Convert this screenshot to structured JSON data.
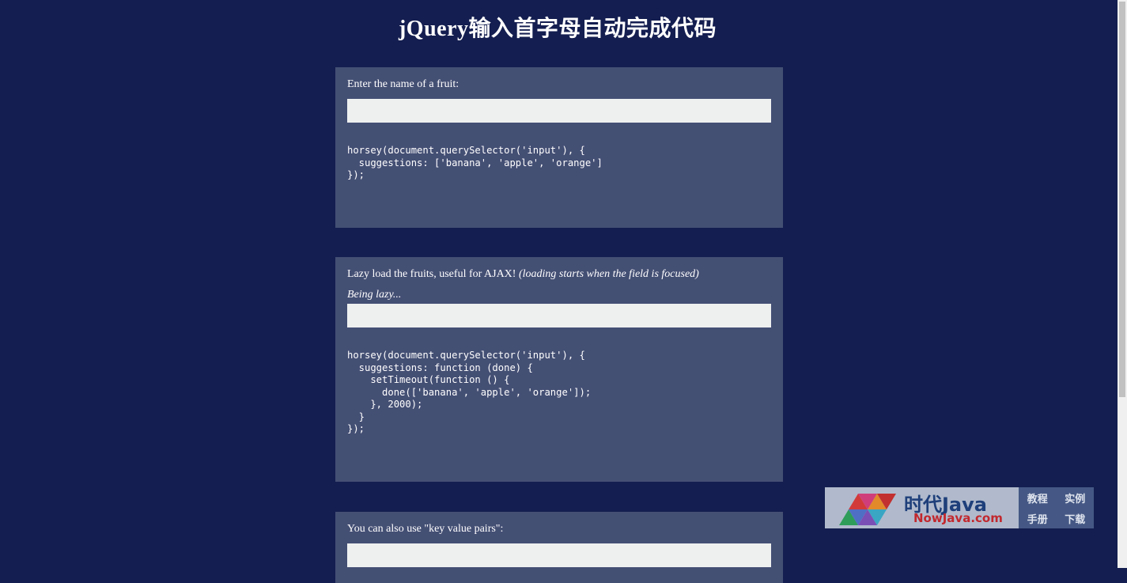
{
  "page": {
    "title": "jQuery输入首字母自动完成代码"
  },
  "sections": [
    {
      "label": "Enter the name of a fruit:",
      "input_value": "",
      "code": "horsey(document.querySelector('input'), {\n  suggestions: ['banana', 'apple', 'orange']\n});"
    },
    {
      "label": "Lazy load the fruits, useful for AJAX!",
      "label_note": "(loading starts when the field is focused)",
      "status": "Being lazy...",
      "input_value": "",
      "code": "horsey(document.querySelector('input'), {\n  suggestions: function (done) {\n    setTimeout(function () {\n      done(['banana', 'apple', 'orange']);\n    }, 2000);\n  }\n});"
    },
    {
      "label": "You can also use \"key value pairs\":",
      "input_value": ""
    }
  ],
  "watermark": {
    "brand_cn": "时代Java",
    "brand_en": "NowJava.com",
    "links": [
      "教程",
      "实例",
      "手册",
      "下载"
    ]
  },
  "colors": {
    "background": "#141e50",
    "panel": "#444f74",
    "input": "#eef0f0",
    "text": "#ffffff"
  }
}
